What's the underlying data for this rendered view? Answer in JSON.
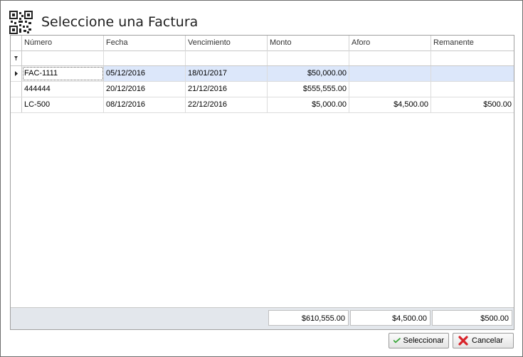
{
  "title": "Seleccione una Factura",
  "icons": {
    "header": "qr-code-icon",
    "row_indicator": "row-pointer-icon",
    "filter": "filter-icon",
    "select": "check-icon",
    "cancel": "x-icon"
  },
  "colors": {
    "selected_row": "#dce7fa",
    "footer": "#e3e7ec",
    "cancel_icon": "#d8232a",
    "select_icon": "#3aa63a"
  },
  "columns": [
    {
      "label": "Número"
    },
    {
      "label": "Fecha"
    },
    {
      "label": "Vencimiento"
    },
    {
      "label": "Monto"
    },
    {
      "label": "Aforo"
    },
    {
      "label": "Remanente"
    }
  ],
  "rows": [
    {
      "numero": "FAC-1111",
      "fecha": "05/12/2016",
      "vencimiento": "18/01/2017",
      "monto": "$50,000.00",
      "aforo": "",
      "remanente": ""
    },
    {
      "numero": "444444",
      "fecha": "20/12/2016",
      "vencimiento": "21/12/2016",
      "monto": "$555,555.00",
      "aforo": "",
      "remanente": ""
    },
    {
      "numero": "LC-500",
      "fecha": "08/12/2016",
      "vencimiento": "22/12/2016",
      "monto": "$5,000.00",
      "aforo": "$4,500.00",
      "remanente": "$500.00"
    }
  ],
  "totals": {
    "monto": "$610,555.00",
    "aforo": "$4,500.00",
    "remanente": "$500.00"
  },
  "buttons": {
    "select": "Seleccionar",
    "cancel": "Cancelar"
  }
}
